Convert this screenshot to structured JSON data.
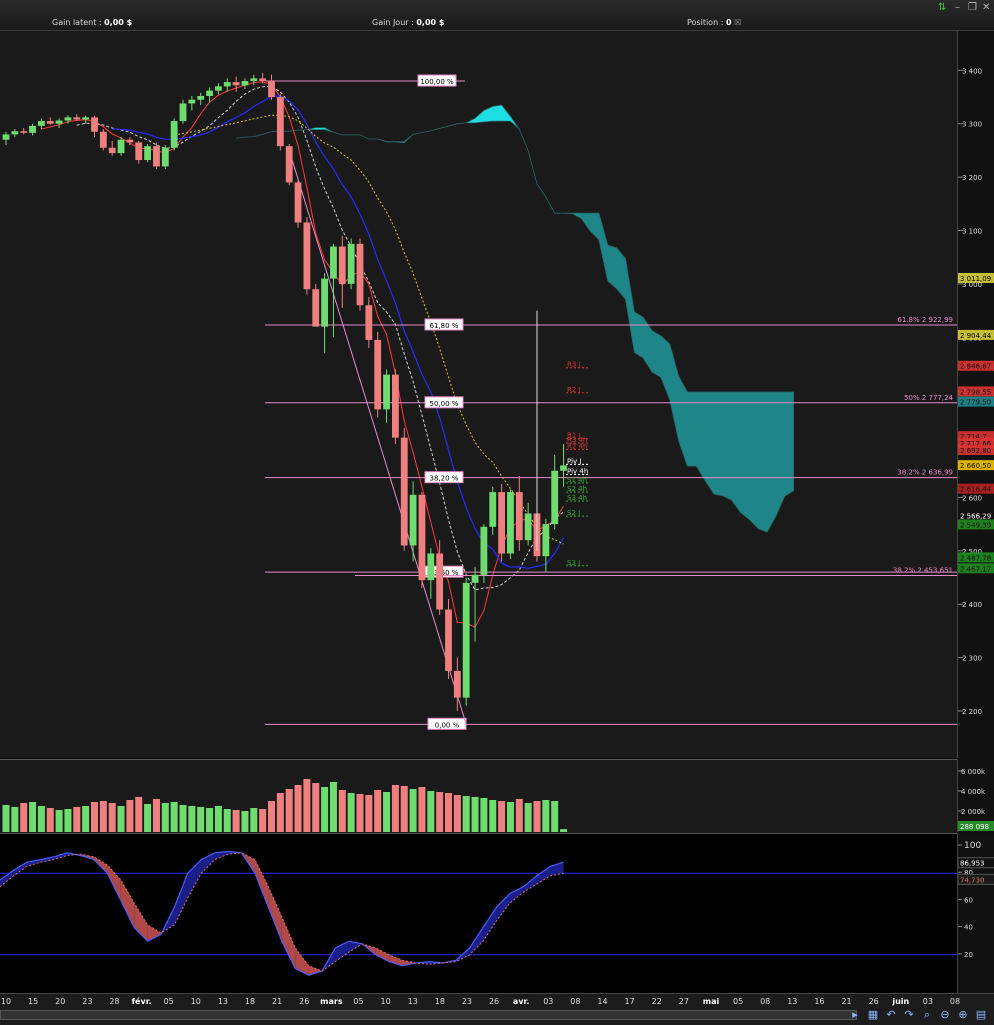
{
  "header": {
    "gain_latent_label": "Gain latent :",
    "gain_latent_value": "0,00 $",
    "gain_jour_label": "Gain Jour :",
    "gain_jour_value": "0,00 $",
    "position_label": "Position :",
    "position_value": "0"
  },
  "colors": {
    "up": "#6fdc6f",
    "down": "#f07f7f",
    "fib_line": "#e58ac9",
    "cloud_top": "#1de9ee",
    "cloud_teal": "#1f8c8f",
    "stoch_fill_up": "#1b1f8a",
    "stoch_fill_down": "#b04848"
  },
  "chart_data": [
    {
      "type": "candlestick",
      "x": [
        "08/01",
        "09/01",
        "10/01",
        "11/01",
        "12/01",
        "15/01",
        "16/01",
        "17/01",
        "18/01",
        "19/01",
        "22/01",
        "23/01",
        "24/01",
        "25/01",
        "26/01",
        "29/01",
        "30/01",
        "31/01",
        "01/02",
        "02/02",
        "05/02",
        "06/02",
        "07/02",
        "08/02",
        "09/02",
        "12/02",
        "13/02",
        "14/02",
        "15/02",
        "16/02",
        "20/02",
        "21/02",
        "22/02",
        "23/02",
        "26/02",
        "27/02",
        "28/02",
        "01/03",
        "02/03",
        "05/03",
        "06/03",
        "07/03",
        "08/03",
        "09/03",
        "12/03",
        "13/03",
        "14/03",
        "15/03",
        "16/03",
        "19/03",
        "20/03",
        "21/03",
        "22/03",
        "23/03",
        "26/03",
        "27/03",
        "28/03",
        "29/03",
        "02/04",
        "03/04",
        "04/04",
        "05/04",
        "06/04",
        "09/04"
      ],
      "ohlc": [
        [
          3270,
          3285,
          3260,
          3280
        ],
        [
          3280,
          3290,
          3275,
          3286
        ],
        [
          3286,
          3292,
          3280,
          3283
        ],
        [
          3283,
          3300,
          3278,
          3296
        ],
        [
          3296,
          3310,
          3290,
          3305
        ],
        [
          3305,
          3312,
          3298,
          3300
        ],
        [
          3300,
          3310,
          3292,
          3306
        ],
        [
          3306,
          3316,
          3300,
          3312
        ],
        [
          3312,
          3318,
          3305,
          3308
        ],
        [
          3308,
          3315,
          3300,
          3312
        ],
        [
          3312,
          3315,
          3275,
          3285
        ],
        [
          3285,
          3290,
          3250,
          3255
        ],
        [
          3255,
          3268,
          3240,
          3245
        ],
        [
          3245,
          3275,
          3240,
          3270
        ],
        [
          3270,
          3275,
          3260,
          3265
        ],
        [
          3265,
          3268,
          3225,
          3232
        ],
        [
          3232,
          3262,
          3228,
          3258
        ],
        [
          3258,
          3265,
          3215,
          3220
        ],
        [
          3220,
          3260,
          3215,
          3255
        ],
        [
          3255,
          3310,
          3250,
          3305
        ],
        [
          3305,
          3345,
          3300,
          3338
        ],
        [
          3338,
          3352,
          3325,
          3345
        ],
        [
          3345,
          3358,
          3335,
          3352
        ],
        [
          3352,
          3368,
          3340,
          3362
        ],
        [
          3362,
          3376,
          3355,
          3370
        ],
        [
          3370,
          3385,
          3360,
          3378
        ],
        [
          3378,
          3388,
          3360,
          3372
        ],
        [
          3372,
          3385,
          3365,
          3380
        ],
        [
          3380,
          3392,
          3372,
          3385
        ],
        [
          3385,
          3395,
          3375,
          3380
        ],
        [
          3380,
          3392,
          3345,
          3350
        ],
        [
          3350,
          3355,
          3250,
          3258
        ],
        [
          3258,
          3262,
          3185,
          3190
        ],
        [
          3190,
          3195,
          3105,
          3115
        ],
        [
          3115,
          3125,
          2980,
          2990
        ],
        [
          2990,
          3000,
          2930,
          2920
        ],
        [
          2920,
          3020,
          2870,
          3010
        ],
        [
          3010,
          3075,
          2900,
          3070
        ],
        [
          3070,
          3090,
          2955,
          3000
        ],
        [
          3000,
          3085,
          2990,
          3075
        ],
        [
          3075,
          3085,
          2950,
          2960
        ],
        [
          2960,
          2975,
          2880,
          2895
        ],
        [
          2895,
          2910,
          2750,
          2765
        ],
        [
          2765,
          2840,
          2740,
          2830
        ],
        [
          2830,
          2840,
          2700,
          2712
        ],
        [
          2712,
          2730,
          2500,
          2510
        ],
        [
          2510,
          2630,
          2480,
          2605
        ],
        [
          2605,
          2610,
          2430,
          2445
        ],
        [
          2445,
          2505,
          2410,
          2495
        ],
        [
          2495,
          2520,
          2380,
          2390
        ],
        [
          2390,
          2410,
          2260,
          2275
        ],
        [
          2275,
          2300,
          2200,
          2225
        ],
        [
          2225,
          2450,
          2210,
          2440
        ],
        [
          2440,
          2470,
          2330,
          2455
        ],
        [
          2455,
          2550,
          2440,
          2545
        ],
        [
          2545,
          2620,
          2530,
          2610
        ],
        [
          2610,
          2625,
          2480,
          2495
        ],
        [
          2495,
          2615,
          2485,
          2610
        ],
        [
          2610,
          2640,
          2500,
          2520
        ],
        [
          2520,
          2590,
          2510,
          2570
        ],
        [
          2570,
          2580,
          2480,
          2490
        ],
        [
          2490,
          2560,
          2460,
          2550
        ],
        [
          2550,
          2680,
          2540,
          2650
        ],
        [
          2650,
          2700,
          2620,
          2660
        ]
      ],
      "volume": [
        2700,
        2500,
        2900,
        3000,
        2600,
        2400,
        2200,
        2300,
        2500,
        2600,
        3000,
        3100,
        2900,
        2600,
        3200,
        3500,
        2800,
        3300,
        2900,
        3000,
        2700,
        2600,
        2500,
        2400,
        2600,
        2300,
        2200,
        2100,
        2400,
        2300,
        3100,
        3900,
        4300,
        4700,
        5300,
        4900,
        4500,
        5000,
        4200,
        3900,
        3800,
        3700,
        4200,
        4000,
        4700,
        4600,
        4300,
        4500,
        4100,
        4000,
        3900,
        3700,
        3600,
        3500,
        3400,
        3200,
        3100,
        3000,
        3300,
        2900,
        3100,
        3200,
        3100,
        288
      ],
      "ylim": [
        2140,
        3440
      ],
      "yticks": [
        "3 400",
        "3 300",
        "3 200",
        "3 100",
        "3 000",
        "2 900",
        "2 800",
        "2 700",
        "2 600",
        "2 500",
        "2 400",
        "2 300",
        "2 200"
      ],
      "price_labels": [
        {
          "text": "3 011,09",
          "value": 3011.09,
          "color": "#d7d23a"
        },
        {
          "text": "2 904,44",
          "value": 2904.44,
          "color": "#d7d23a"
        },
        {
          "text": "2 846,67",
          "value": 2846.67,
          "color": "#d33"
        },
        {
          "text": "2 798,55",
          "value": 2798.55,
          "color": "#d33"
        },
        {
          "text": "2 779,50",
          "value": 2779.5,
          "color": "#1f8c8f"
        },
        {
          "text": "2 714,7",
          "value": 2714.7,
          "color": "#d33"
        },
        {
          "text": "2 712,66",
          "value": 2701.66,
          "color": "#d33"
        },
        {
          "text": "2 692,80",
          "value": 2688.8,
          "color": "#d33"
        },
        {
          "text": "2 660,50",
          "value": 2660.5,
          "color": "#f2c400"
        },
        {
          "text": "2 616,44",
          "value": 2616.44,
          "color": "#b22"
        },
        {
          "text": "2 566,29",
          "value": 2566.29,
          "color": "#ffffff"
        },
        {
          "text": "2 549,39",
          "value": 2549.39,
          "color": "#1f8c1f"
        },
        {
          "text": "2 487,78",
          "value": 2487.78,
          "color": "#1f8c1f"
        },
        {
          "text": "2 467,17",
          "value": 2467.17,
          "color": "#1f8c1f"
        }
      ],
      "fib_levels": [
        {
          "label": "100,00 %",
          "value": 3380
        },
        {
          "label": "61,80 %",
          "value": 2922.99
        },
        {
          "label": "50,00 %",
          "value": 2777.24
        },
        {
          "label": "38,20 %",
          "value": 2636.99
        },
        {
          "label": "23,60 %",
          "value": 2460
        },
        {
          "label": "0,00 %",
          "value": 2175
        }
      ],
      "fib_right_labels": [
        {
          "text": "61.8% 2 922,99",
          "value": 2922.99
        },
        {
          "text": "50% 2 777,24",
          "value": 2777.24
        },
        {
          "text": "38.2% 2 636,99",
          "value": 2636.99
        },
        {
          "text": "38.2% 2 453,651",
          "value": 2453.651
        }
      ],
      "pivot_labels": [
        {
          "text": "R3 J",
          "value": 2843,
          "color": "#d33"
        },
        {
          "text": "R2 J",
          "value": 2796,
          "color": "#d33"
        },
        {
          "text": "R1 J",
          "value": 2710,
          "color": "#d33"
        },
        {
          "text": "R3 4h",
          "value": 2702,
          "color": "#d33"
        },
        {
          "text": "R2 4h",
          "value": 2690,
          "color": "#d33"
        },
        {
          "text": "Piv J",
          "value": 2662,
          "color": "#ffffff"
        },
        {
          "text": "Piv 4h",
          "value": 2643,
          "color": "#ffffff"
        },
        {
          "text": "S1 4h",
          "value": 2627,
          "color": "#2bb02b"
        },
        {
          "text": "S2 4h",
          "value": 2610,
          "color": "#2bb02b"
        },
        {
          "text": "S3 4h",
          "value": 2593,
          "color": "#2bb02b"
        },
        {
          "text": "S2 J",
          "value": 2565,
          "color": "#2bb02b"
        },
        {
          "text": "S3 J",
          "value": 2472,
          "color": "#2bb02b"
        }
      ],
      "volume_ticks": [
        "6 000k",
        "4 000k",
        "2 000k"
      ],
      "volume_last_label": "288 098",
      "stoch_ticks": [
        "100",
        "80",
        "60",
        "40",
        "20"
      ],
      "stoch_k_label": "86,953",
      "stoch_d_label": "74,730",
      "stoch_k": [
        75,
        82,
        88,
        90,
        92,
        95,
        93,
        90,
        80,
        60,
        40,
        30,
        35,
        55,
        80,
        90,
        95,
        96,
        95,
        80,
        55,
        30,
        10,
        5,
        8,
        25,
        30,
        28,
        20,
        15,
        12,
        14,
        15,
        14,
        16,
        25,
        40,
        55,
        65,
        70,
        78,
        85,
        88
      ],
      "stoch_d": [
        70,
        78,
        85,
        88,
        90,
        93,
        94,
        92,
        86,
        75,
        58,
        42,
        36,
        42,
        62,
        80,
        90,
        94,
        95,
        90,
        70,
        48,
        25,
        12,
        8,
        15,
        22,
        28,
        25,
        20,
        16,
        14,
        13,
        14,
        15,
        20,
        30,
        45,
        58,
        66,
        72,
        78,
        80
      ],
      "date_ticks": [
        {
          "label": "10",
          "bold": false
        },
        {
          "label": "15",
          "bold": false
        },
        {
          "label": "20",
          "bold": false
        },
        {
          "label": "23",
          "bold": false
        },
        {
          "label": "28",
          "bold": false
        },
        {
          "label": "févr.",
          "bold": true
        },
        {
          "label": "05",
          "bold": false
        },
        {
          "label": "10",
          "bold": false
        },
        {
          "label": "13",
          "bold": false
        },
        {
          "label": "18",
          "bold": false
        },
        {
          "label": "21",
          "bold": false
        },
        {
          "label": "26",
          "bold": false
        },
        {
          "label": "mars",
          "bold": true
        },
        {
          "label": "05",
          "bold": false
        },
        {
          "label": "10",
          "bold": false
        },
        {
          "label": "13",
          "bold": false
        },
        {
          "label": "18",
          "bold": false
        },
        {
          "label": "23",
          "bold": false
        },
        {
          "label": "26",
          "bold": false
        },
        {
          "label": "avr.",
          "bold": true
        },
        {
          "label": "03",
          "bold": false
        },
        {
          "label": "08",
          "bold": false
        },
        {
          "label": "14",
          "bold": false
        },
        {
          "label": "17",
          "bold": false
        },
        {
          "label": "22",
          "bold": false
        },
        {
          "label": "27",
          "bold": false
        },
        {
          "label": "mai",
          "bold": true
        },
        {
          "label": "05",
          "bold": false
        },
        {
          "label": "08",
          "bold": false
        },
        {
          "label": "13",
          "bold": false
        },
        {
          "label": "16",
          "bold": false
        },
        {
          "label": "21",
          "bold": false
        },
        {
          "label": "26",
          "bold": false
        },
        {
          "label": "juin",
          "bold": true
        },
        {
          "label": "03",
          "bold": false
        },
        {
          "label": "08",
          "bold": false
        }
      ]
    }
  ]
}
